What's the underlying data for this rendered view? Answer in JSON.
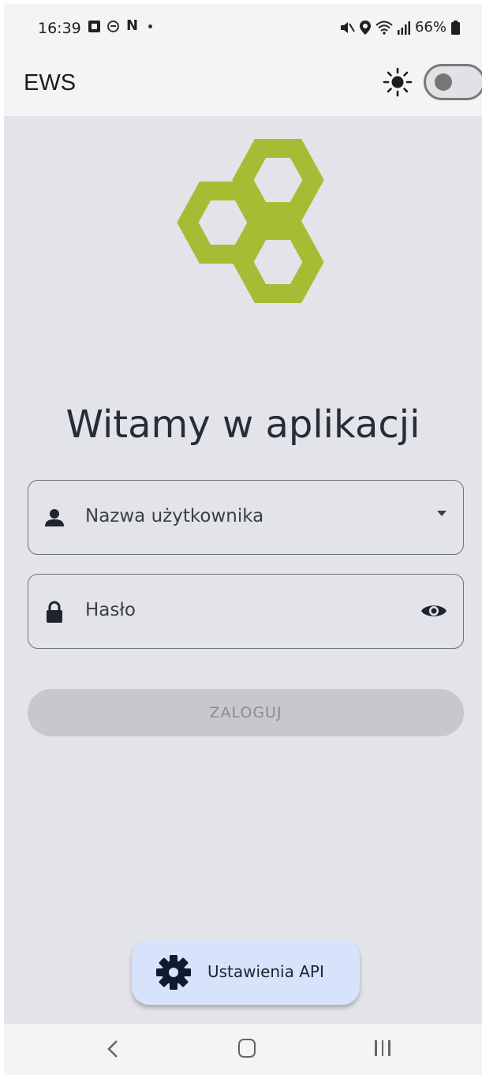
{
  "status_bar": {
    "time": "16:39",
    "battery": "66%"
  },
  "app_bar": {
    "title": "EWS",
    "theme_toggle_on": false
  },
  "main": {
    "welcome": "Witamy w aplikacji",
    "username_placeholder": "Nazwa użytkownika",
    "password_placeholder": "Hasło",
    "login_label": "ZALOGUJ",
    "api_settings_label": "Ustawienia API"
  },
  "colors": {
    "logo_green": "#a5bd35",
    "background": "#e3e4e9",
    "api_button": "#d6e3fb"
  },
  "icons": {
    "user": "person-icon",
    "password": "lock-icon",
    "dropdown": "caret-down-icon",
    "visibility": "eye-icon",
    "settings": "gear-icon",
    "theme": "sun-icon"
  }
}
